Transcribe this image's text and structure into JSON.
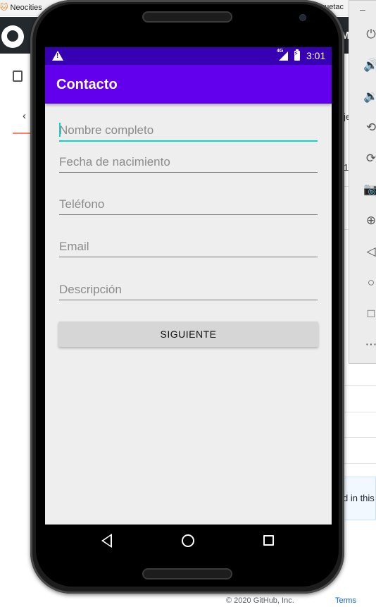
{
  "browser": {
    "tabs": [
      {
        "label": "Neocities"
      },
      {
        "label": "quetac"
      }
    ]
  },
  "github": {
    "header_partial": "M",
    "right_texts": [
      "je",
      "1",
      "d in this"
    ],
    "footer_copyright": "© 2020 GitHub, Inc.",
    "footer_terms": "Terms"
  },
  "emulator_toolbar": {
    "minimize": "–",
    "buttons": [
      {
        "name": "power-icon",
        "glyph": "⏻"
      },
      {
        "name": "volume-up-icon",
        "glyph": "🔊"
      },
      {
        "name": "volume-down-icon",
        "glyph": "🔉"
      },
      {
        "name": "rotate-left-icon",
        "glyph": "⟲"
      },
      {
        "name": "rotate-right-icon",
        "glyph": "⟳"
      },
      {
        "name": "camera-icon",
        "glyph": "📷"
      },
      {
        "name": "zoom-icon",
        "glyph": "⊕"
      },
      {
        "name": "back-icon",
        "glyph": "◁"
      },
      {
        "name": "home-icon",
        "glyph": "○"
      },
      {
        "name": "overview-icon",
        "glyph": "□"
      },
      {
        "name": "more-icon",
        "glyph": "⋯"
      }
    ]
  },
  "status_bar": {
    "network": "4G",
    "time": "3:01",
    "color": "#3700b3"
  },
  "app_bar": {
    "title": "Contacto",
    "color": "#6200ee"
  },
  "form": {
    "fields": [
      {
        "placeholder": "Nombre completo",
        "value": "",
        "focused": true
      },
      {
        "placeholder": "Fecha de nacimiento",
        "value": ""
      },
      {
        "placeholder": "Teléfono",
        "value": ""
      },
      {
        "placeholder": "Email",
        "value": ""
      },
      {
        "placeholder": "Descripción",
        "value": ""
      }
    ],
    "accent_color": "#03dac5",
    "next_button": "SIGUIENTE"
  }
}
